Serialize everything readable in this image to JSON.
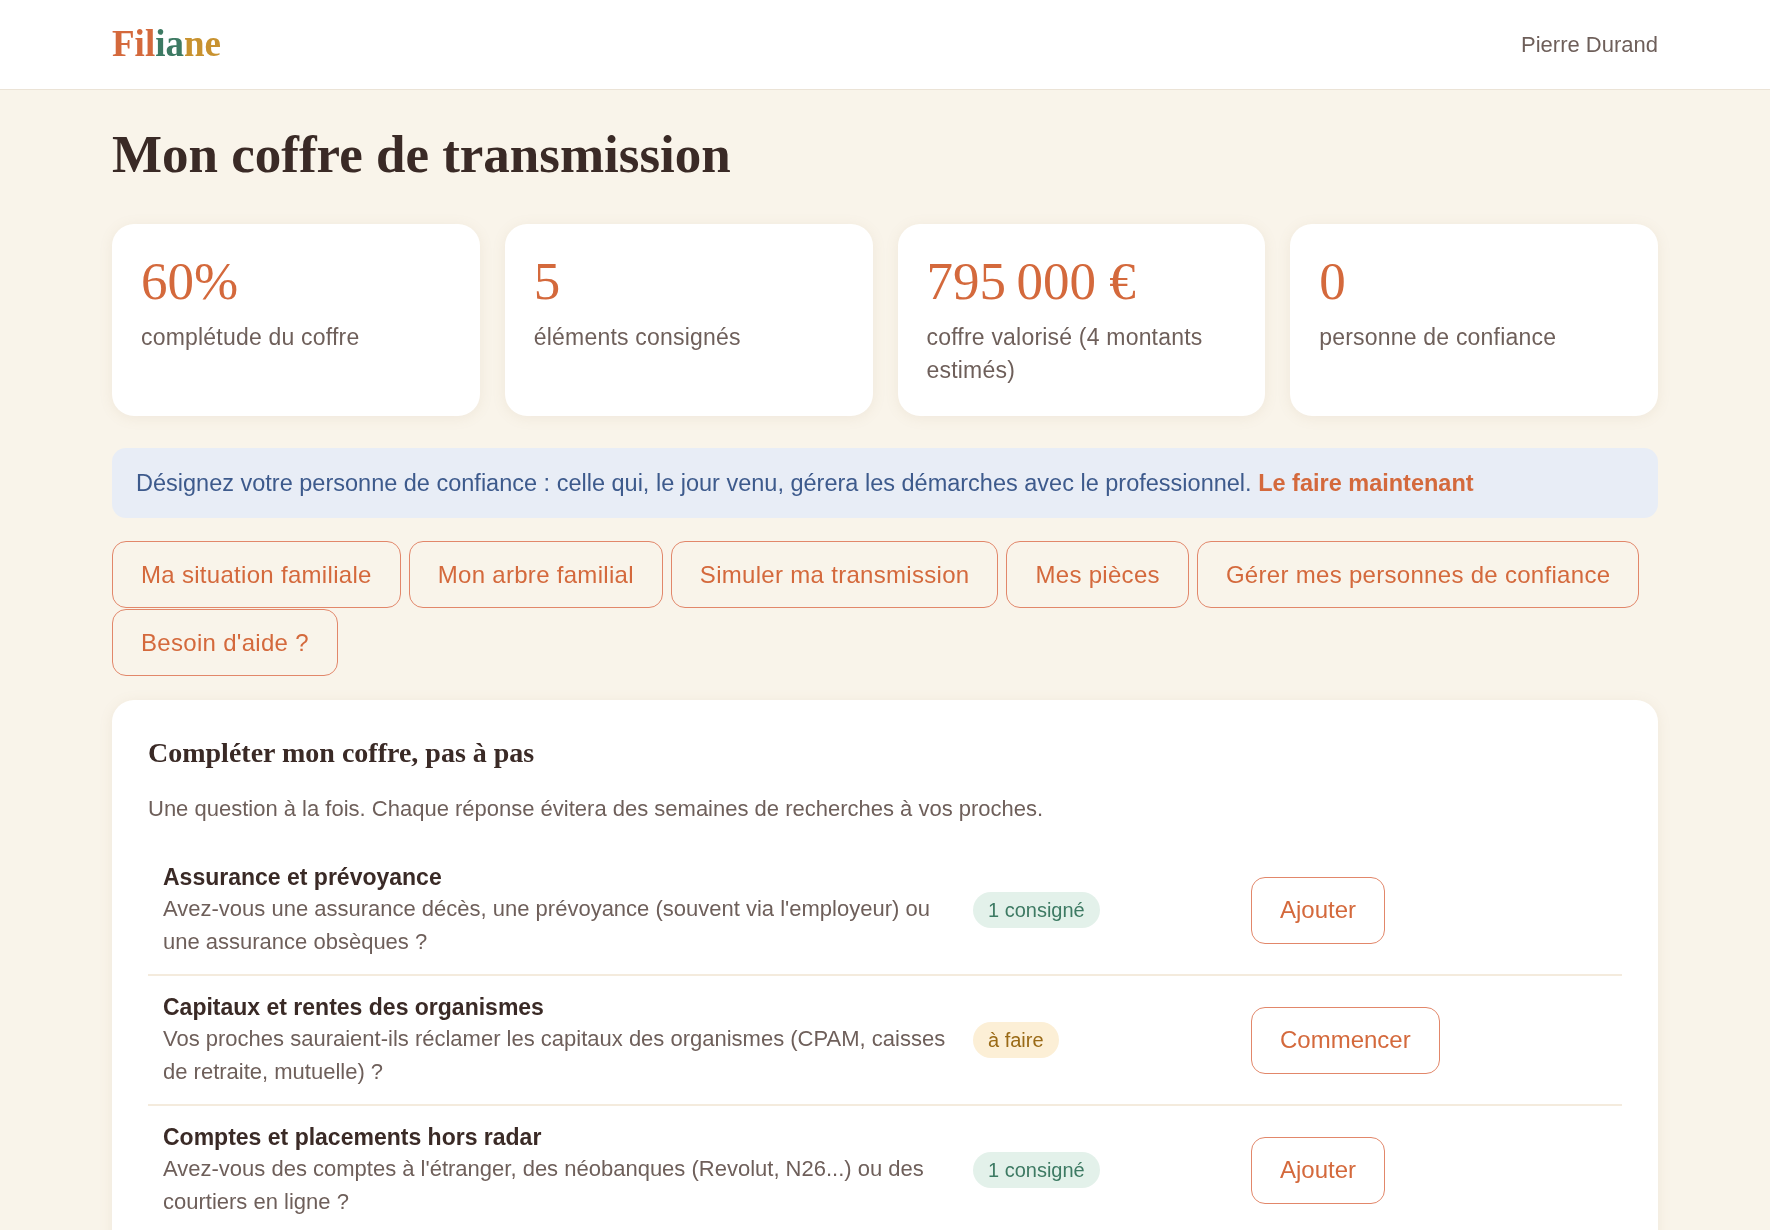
{
  "header": {
    "logo": [
      {
        "text": "Fil",
        "color": "#d4693c"
      },
      {
        "text": "ia",
        "color": "#3d7a63"
      },
      {
        "text": "ne",
        "color": "#c8922f"
      }
    ],
    "user_name": "Pierre Durand"
  },
  "page_title": "Mon coffre de transmission",
  "stats": [
    {
      "value": "60%",
      "label": "complétude du coffre"
    },
    {
      "value": "5",
      "label": "éléments consignés"
    },
    {
      "value": "795 000 €",
      "label": "coffre valorisé (4 montants estimés)"
    },
    {
      "value": "0",
      "label": "personne de confiance"
    }
  ],
  "notice": {
    "text": "Désignez votre personne de confiance : celle qui, le jour venu, gérera les démarches avec le professionnel.",
    "link": "Le faire maintenant"
  },
  "actions": [
    "Ma situation familiale",
    "Mon arbre familial",
    "Simuler ma transmission",
    "Mes pièces",
    "Gérer mes personnes de confiance",
    "Besoin d'aide ?"
  ],
  "steps_panel": {
    "title": "Compléter mon coffre, pas à pas",
    "subtitle": "Une question à la fois. Chaque réponse évitera des semaines de recherches à vos proches.",
    "steps": [
      {
        "title": "Assurance et prévoyance",
        "question": "Avez-vous une assurance décès, une prévoyance (souvent via l'employeur) ou une assurance obsèques ?",
        "status": {
          "kind": "done",
          "label": "1 consigné"
        },
        "action": "Ajouter"
      },
      {
        "title": "Capitaux et rentes des organismes",
        "question": "Vos proches sauraient-ils réclamer les capitaux des organismes (CPAM, caisses de retraite, mutuelle) ?",
        "status": {
          "kind": "todo",
          "label": "à faire"
        },
        "action": "Commencer"
      },
      {
        "title": "Comptes et placements hors radar",
        "question": "Avez-vous des comptes à l'étranger, des néobanques (Revolut, N26...) ou des courtiers en ligne ?",
        "status": {
          "kind": "done",
          "label": "1 consigné"
        },
        "action": "Ajouter"
      }
    ]
  }
}
